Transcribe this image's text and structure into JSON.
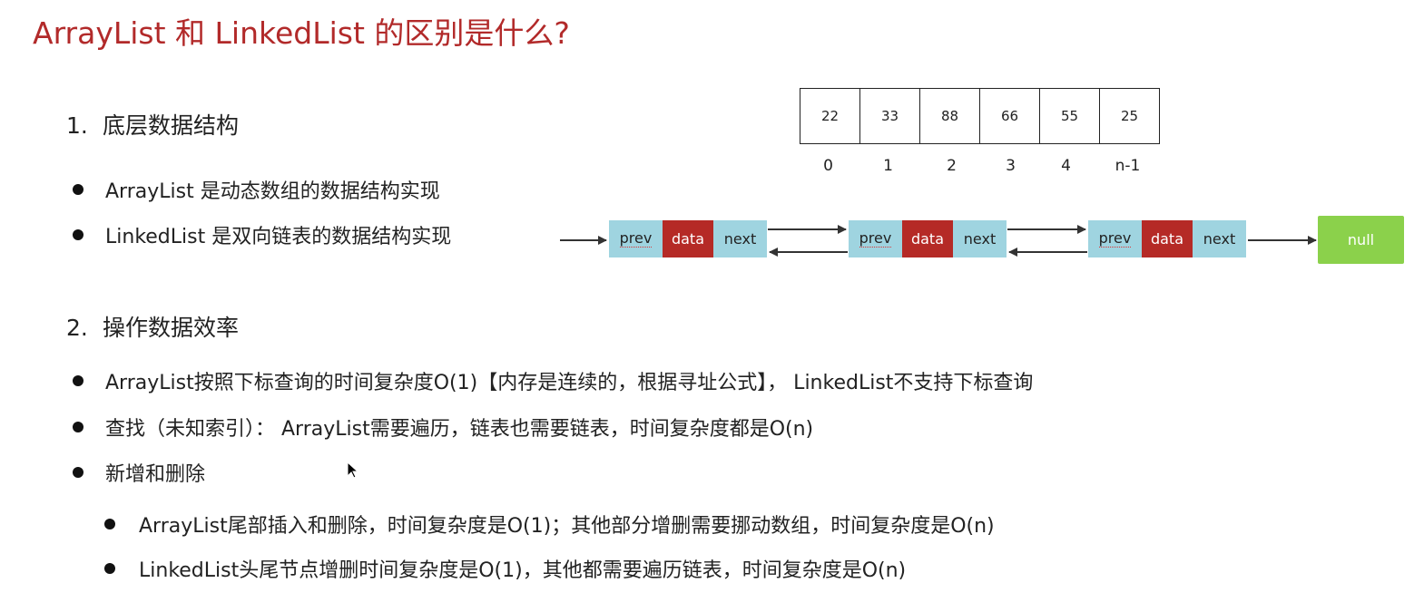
{
  "title": "ArrayList 和 LinkedList 的区别是什么?",
  "section1": {
    "number": "1.",
    "heading": "底层数据结构",
    "bullets": [
      "ArrayList 是动态数组的数据结构实现",
      "LinkedList 是双向链表的数据结构实现"
    ]
  },
  "array_diagram": {
    "values": [
      "22",
      "33",
      "88",
      "66",
      "55",
      "25"
    ],
    "indices": [
      "0",
      "1",
      "2",
      "3",
      "4",
      "n-1"
    ]
  },
  "linked_list_diagram": {
    "nodes": [
      {
        "prev": "prev",
        "data": "data",
        "next": "next"
      },
      {
        "prev": "prev",
        "data": "data",
        "next": "next"
      },
      {
        "prev": "prev",
        "data": "data",
        "next": "next"
      }
    ],
    "terminal": "null"
  },
  "section2": {
    "number": "2.",
    "heading": "操作数据效率",
    "bullets": [
      "ArrayList按照下标查询的时间复杂度O(1)【内存是连续的，根据寻址公式】， LinkedList不支持下标查询",
      "查找（未知索引）： ArrayList需要遍历，链表也需要链表，时间复杂度都是O(n)",
      "新增和删除"
    ],
    "sub_bullets": [
      "ArrayList尾部插入和删除，时间复杂度是O(1)；其他部分增删需要挪动数组，时间复杂度是O(n)",
      "LinkedList头尾节点增删时间复杂度是O(1)，其他都需要遍历链表，时间复杂度是O(n)"
    ]
  },
  "colors": {
    "title": "#b22a2a",
    "node_pointer": "#9fd4e0",
    "node_data": "#b52a26",
    "null_box": "#8bd14b"
  }
}
